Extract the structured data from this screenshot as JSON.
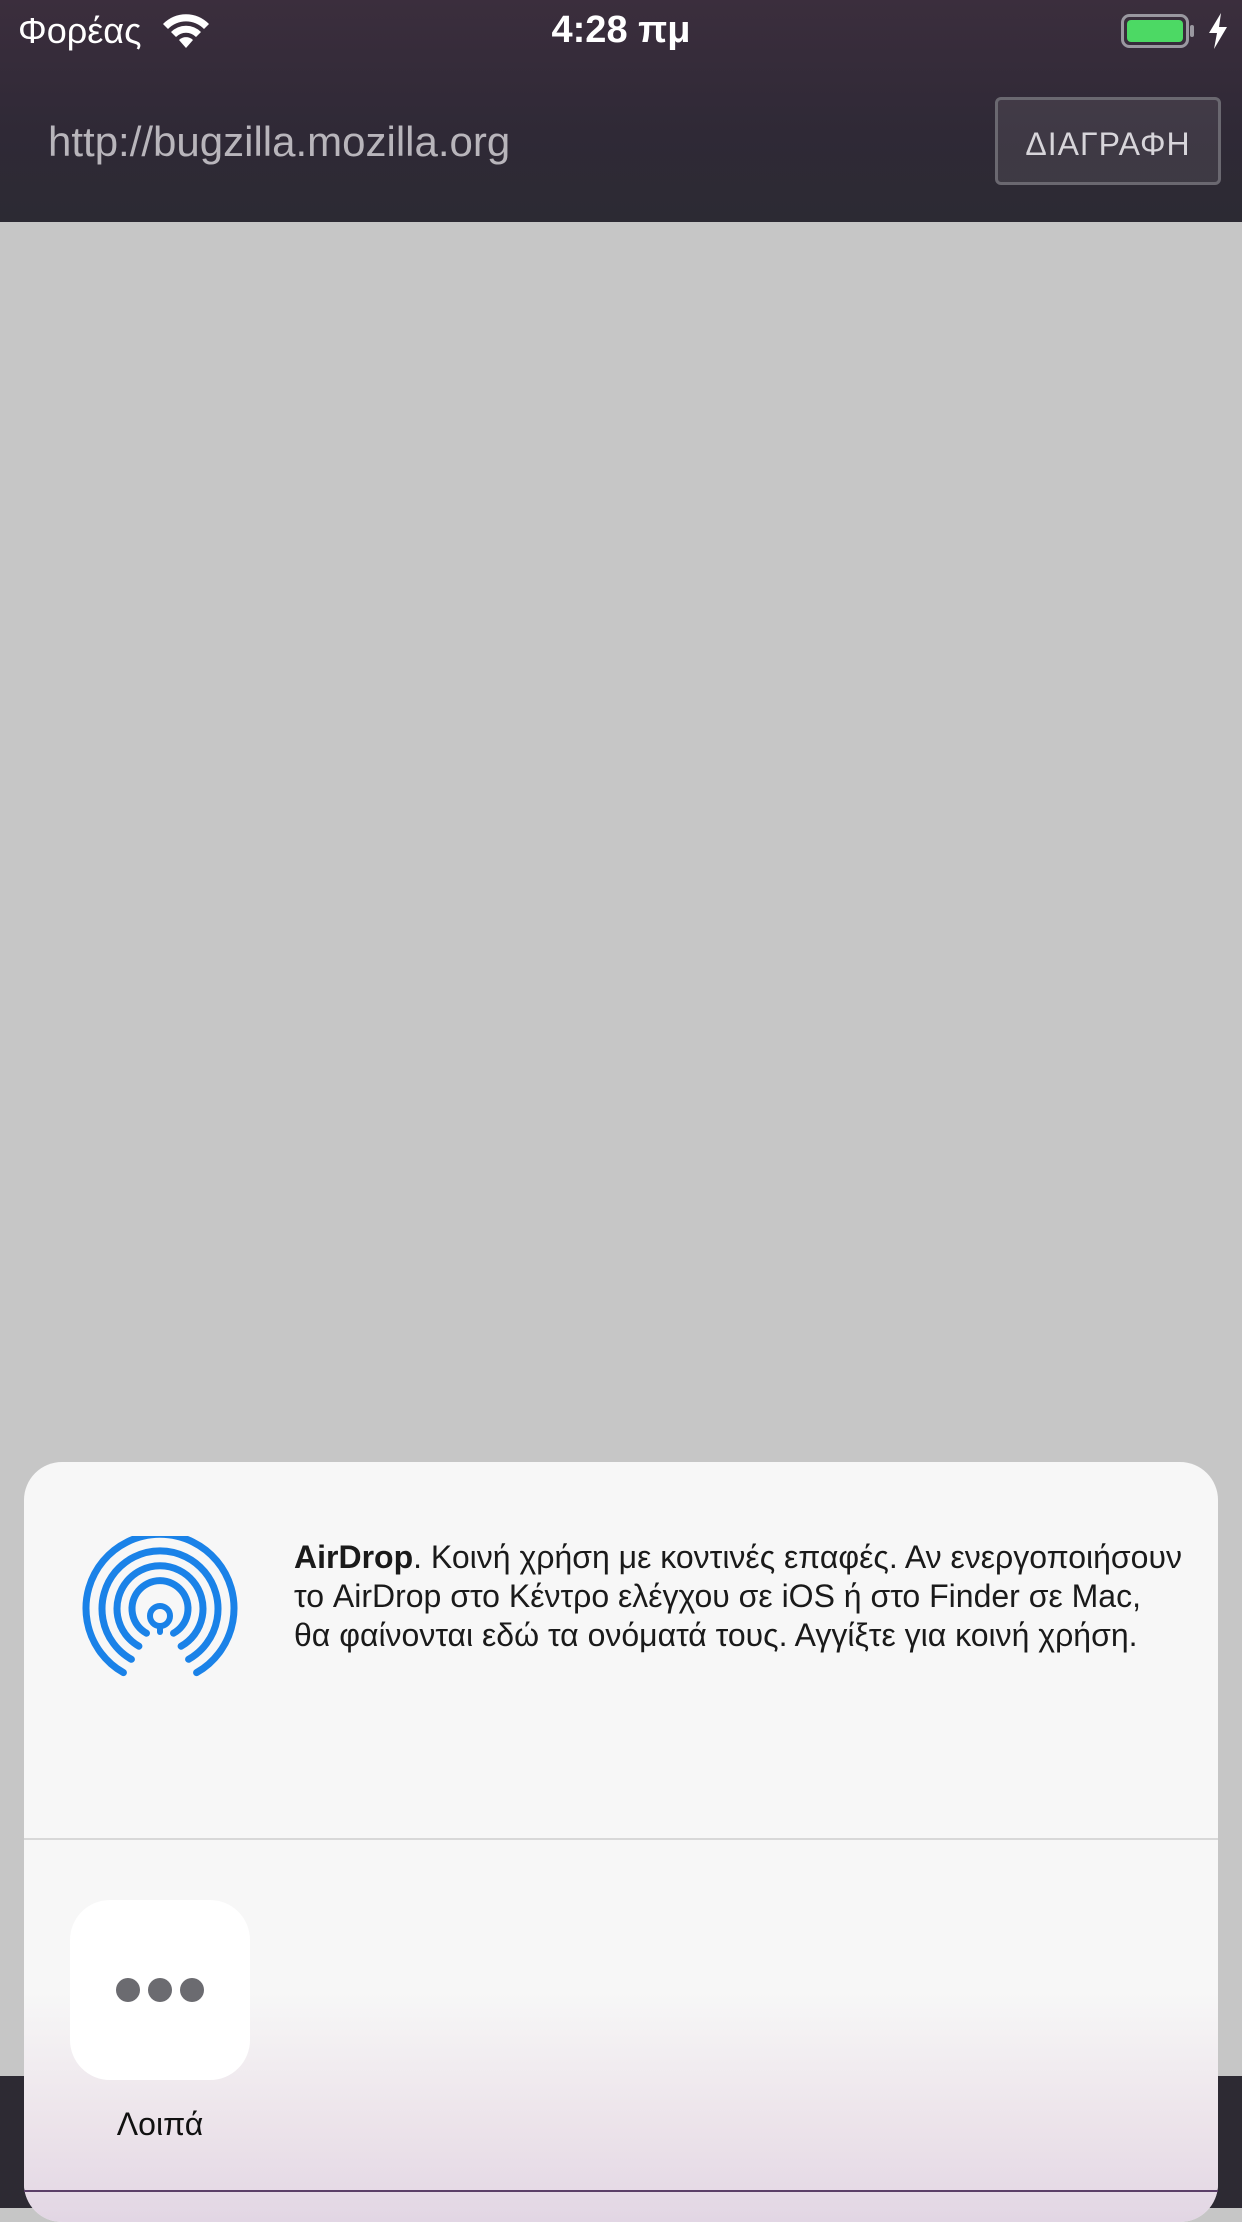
{
  "status_bar": {
    "carrier": "Φορέας",
    "time": "4:28 πμ",
    "wifi_icon": "wifi-icon",
    "battery_icon": "battery-icon",
    "battery_color": "#4cd964",
    "charge_icon": "charging-bolt-icon"
  },
  "toolbar": {
    "url": "http://bugzilla.mozilla.org",
    "clear_label": "ΔΙΑΓΡΑΦΗ"
  },
  "share_sheet": {
    "airdrop": {
      "icon": "airdrop-icon",
      "icon_color": "#1a82e8",
      "title": "AirDrop",
      "description": ". Κοινή χρήση με κοντινές επαφές. Αν ενεργοποιήσουν το AirDrop στο Κέντρο ελέγχου σε iOS ή στο Finder σε Mac, θα φαίνονται εδώ τα ονόματά τους. Αγγίξτε για κοινή χρήση."
    },
    "apps": [
      {
        "label": "Λοιπά",
        "icon": "more-dots-icon"
      }
    ]
  }
}
